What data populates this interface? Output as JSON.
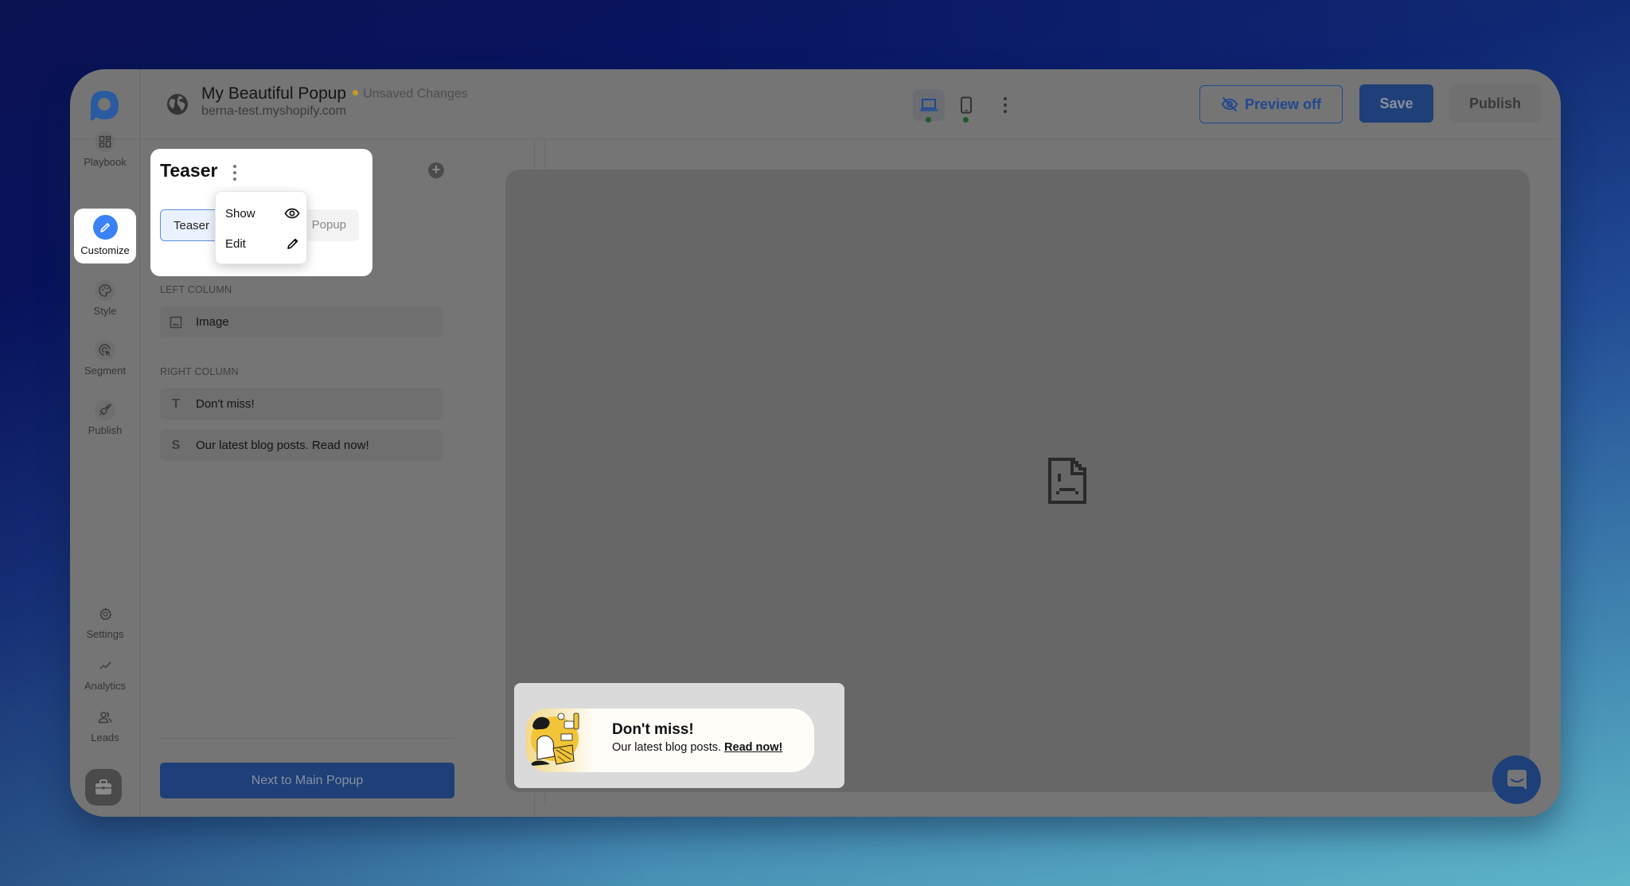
{
  "header": {
    "title": "My Beautiful Popup",
    "status": "Unsaved Changes",
    "subtitle": "berna-test.myshopify.com",
    "devices": [
      {
        "name": "desktop",
        "active": true
      },
      {
        "name": "mobile",
        "active": false
      }
    ],
    "preview_label": "Preview off",
    "save_label": "Save",
    "publish_label": "Publish"
  },
  "sidebar": {
    "items": [
      {
        "label": "Playbook",
        "icon": "grid-icon"
      },
      {
        "label": "Customize",
        "icon": "pencil-icon",
        "active": true
      },
      {
        "label": "Style",
        "icon": "palette-icon"
      },
      {
        "label": "Segment",
        "icon": "target-cursor-icon"
      },
      {
        "label": "Publish",
        "icon": "rocket-icon"
      }
    ],
    "bottom_items": [
      {
        "label": "Settings",
        "icon": "gear-icon"
      },
      {
        "label": "Analytics",
        "icon": "chart-line-icon"
      },
      {
        "label": "Leads",
        "icon": "users-icon"
      }
    ]
  },
  "panel": {
    "title": "Teaser",
    "tabs": [
      {
        "label": "Teaser",
        "active": true
      },
      {
        "label": "Popup",
        "active": false
      }
    ],
    "menu": [
      {
        "label": "Show",
        "icon": "eye-icon"
      },
      {
        "label": "Edit",
        "icon": "pencil-icon"
      }
    ],
    "sections": [
      {
        "label": "LEFT COLUMN",
        "items": [
          {
            "icon": "image-icon",
            "glyph": "",
            "label": "Image"
          }
        ]
      },
      {
        "label": "RIGHT COLUMN",
        "items": [
          {
            "icon": "text-icon",
            "glyph": "T",
            "label": "Don't miss!"
          },
          {
            "icon": "subtext-icon",
            "glyph": "S",
            "label": "Our latest blog posts. Read now!"
          }
        ]
      }
    ],
    "next_button": "Next to Main Popup"
  },
  "preview": {
    "teaser_title": "Don't miss!",
    "teaser_body": "Our latest blog posts.",
    "teaser_link": "Read now!"
  },
  "colors": {
    "accent": "#3b82f6",
    "primary_button": "#1e3f77",
    "status_dot": "#c39a2a",
    "device_active_dot": "#1f5a2a"
  }
}
